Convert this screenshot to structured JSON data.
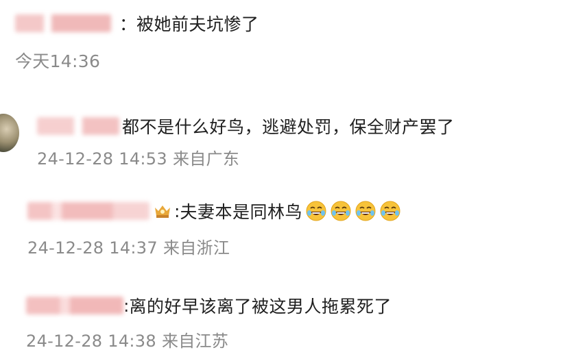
{
  "comments": [
    {
      "separator": "：",
      "text": "被她前夫坑惨了",
      "time": "今天14:36",
      "location": ""
    },
    {
      "separator": "",
      "text": "都不是什么好鸟，逃避处罚，保全财产罢了",
      "time": "24-12-28 14:53",
      "location": "来自广东"
    },
    {
      "separator": ":",
      "text": "夫妻本是同林鸟",
      "time": "24-12-28 14:37",
      "location": "来自浙江",
      "emoji_name": "laughing-crying-face-emoji",
      "emoji_count": 4
    },
    {
      "separator": ":",
      "text": "离的好早该离了被这男人拖累死了",
      "time": "24-12-28 14:38",
      "location": "来自江苏"
    }
  ],
  "colors": {
    "text": "#1f1f1f",
    "meta": "#8a8a8a",
    "blur_pink": "#f2c6c6",
    "badge_gold": "#e8a83a"
  }
}
